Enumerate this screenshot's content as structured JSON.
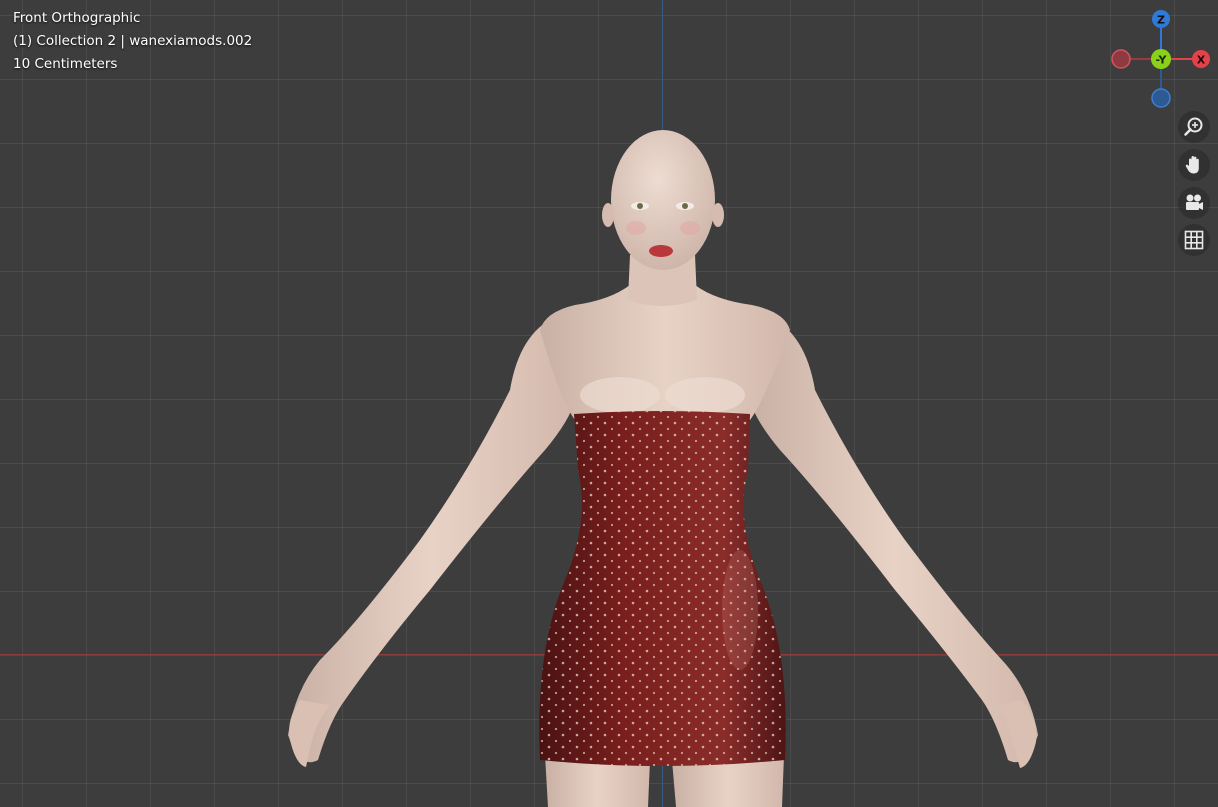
{
  "viewport": {
    "view_name": "Front Orthographic",
    "collection_info": "(1) Collection 2 | wanexiamods.002",
    "grid_scale": "10 Centimeters"
  },
  "gizmo": {
    "z_label": "Z",
    "neg_y_label": "-Y",
    "x_label": "X",
    "colors": {
      "x": "#e2434b",
      "y": "#8ad11a",
      "z": "#2f7ad8"
    }
  },
  "nav_buttons": [
    {
      "icon": "zoom-icon"
    },
    {
      "icon": "hand-pan-icon"
    },
    {
      "icon": "camera-icon"
    },
    {
      "icon": "grid-icon"
    }
  ],
  "colors": {
    "background": "#3d3d3d",
    "skin": "#e3cbbf",
    "dress": "#7a1e1c"
  }
}
